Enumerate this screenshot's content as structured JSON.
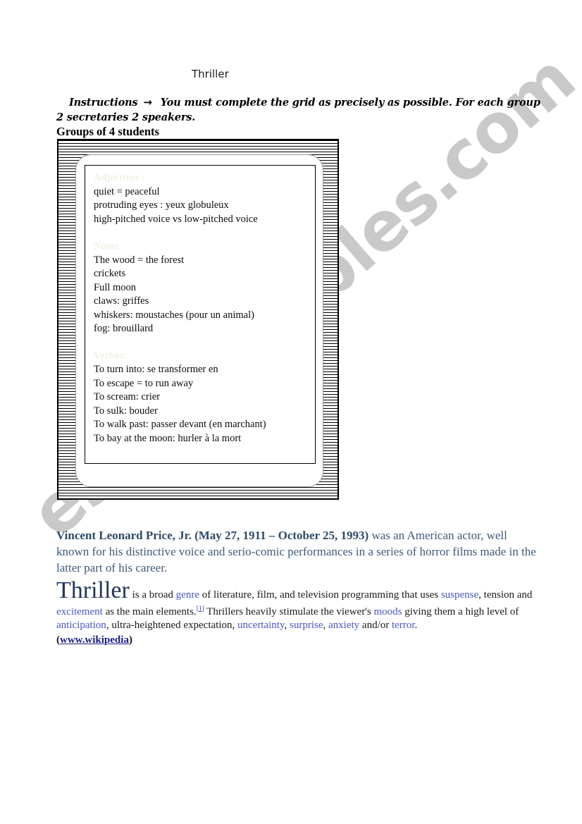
{
  "page": {
    "title": "Thriller"
  },
  "instructions": {
    "label": "Instructions",
    "arrow": "→",
    "text": "You must complete the grid as precisely as possible. For each group 2 secretaries 2 speakers.",
    "groups_line": "Groups of 4 students"
  },
  "wordbox": {
    "sections": [
      {
        "heading": "Adjectives :",
        "items": [
          "quiet = peaceful",
          "protruding eyes : yeux globuleux",
          "high-pitched voice vs low-pitched voice"
        ]
      },
      {
        "heading": "Noms",
        "items": [
          "The wood = the forest",
          "crickets",
          "Full moon",
          "claws: griffes",
          "whiskers: moustaches (pour un animal)",
          "fog: brouillard"
        ]
      },
      {
        "heading": "Verbes:",
        "items": [
          "To turn into: se transformer en",
          "To escape = to run away",
          "To scream: crier",
          "To sulk: bouder",
          "To walk past: passer devant (en marchant)",
          "To bay at the moon: hurler à la mort"
        ]
      }
    ]
  },
  "bio": {
    "name": "Vincent Leonard Price, Jr. (May 27, 1911 – October 25, 1993)",
    "rest": " was an American actor, well known for his distinctive voice and serio-comic performances in a series of horror films made in the latter part of his career."
  },
  "definition": {
    "headword": "Thriller",
    "t1": " is a broad ",
    "link_genre": "genre",
    "t2": " of literature, film, and television programming that uses ",
    "link_suspense": "suspense",
    "t3": ", tension and ",
    "link_excitement": "excitement",
    "t4": " as the main elements.",
    "ref": "[1]",
    "t5": " Thrillers heavily stimulate the viewer's ",
    "link_moods": "moods",
    "t6": " giving them a high level of ",
    "link_anticipation": "anticipation",
    "t7": ", ultra-heightened expectation, ",
    "link_uncertainty": "uncertainty",
    "t8": ", ",
    "link_surprise": "surprise",
    "t9": ", ",
    "link_anxiety": "anxiety",
    "t10": " and/or ",
    "link_terror": "terror",
    "t11": ".",
    "source_open": "(",
    "source_link": "www.wikipedia",
    "source_close": ")"
  },
  "watermark": {
    "text": "esl printables.com"
  },
  "colors": {
    "bio_text": "#3d5a7a",
    "headword": "#22355a",
    "wiki_link": "#4a56c4",
    "source_link": "#1a1a8c",
    "section_heading": "#f2efe4",
    "watermark": "#c9c9c9"
  }
}
